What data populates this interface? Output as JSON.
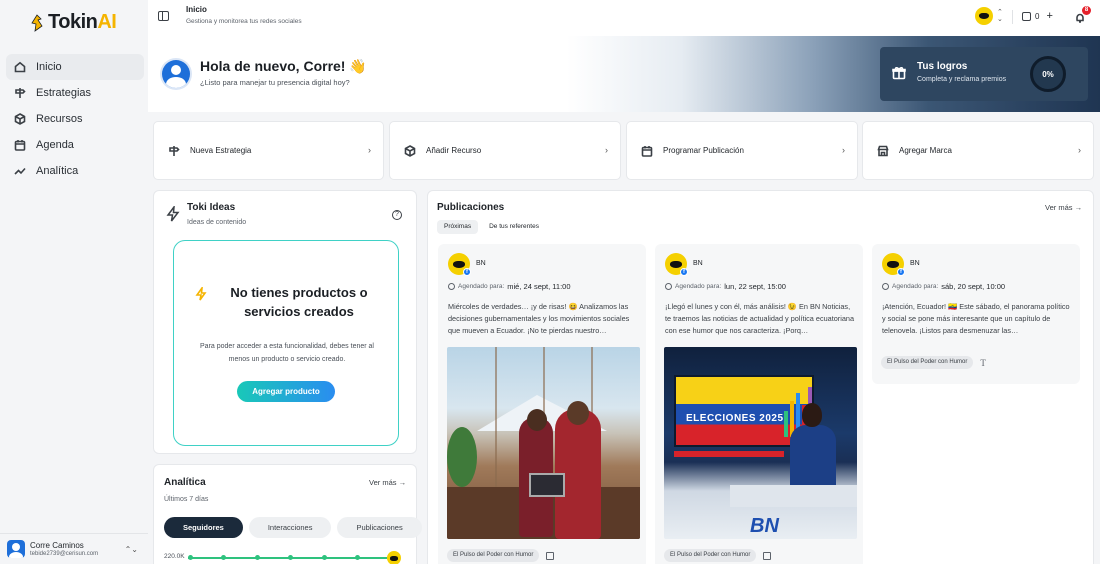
{
  "app": {
    "logo_text": "Tokin",
    "logo_accent": "AI",
    "brand_color": "#f5b400"
  },
  "sidebar": {
    "items": [
      {
        "label": "Inicio",
        "icon": "home-icon",
        "active": true
      },
      {
        "label": "Estrategias",
        "icon": "signpost-icon",
        "active": false
      },
      {
        "label": "Recursos",
        "icon": "package-icon",
        "active": false
      },
      {
        "label": "Agenda",
        "icon": "calendar-icon",
        "active": false
      },
      {
        "label": "Analítica",
        "icon": "trend-icon",
        "active": false
      }
    ],
    "user": {
      "name": "Corre Caminos",
      "email": "tebide2739@cerisun.com"
    }
  },
  "topbar": {
    "title": "Inicio",
    "subtitle": "Gestiona y monitorea tus redes sociales",
    "credits": "0",
    "notifications": "8"
  },
  "hero": {
    "greeting": "Hola de nuevo, Corre! 👋",
    "subtitle": "¿Listo para manejar tu presencia digital hoy?",
    "logros": {
      "title": "Tus logros",
      "subtitle": "Completa y reclama premios",
      "percent": "0%"
    }
  },
  "quick_actions": [
    {
      "label": "Nueva Estrategia",
      "icon": "signpost-icon"
    },
    {
      "label": "Añadir Recurso",
      "icon": "package-icon"
    },
    {
      "label": "Programar Publicación",
      "icon": "calendar-icon"
    },
    {
      "label": "Agregar Marca",
      "icon": "store-icon"
    }
  ],
  "ideas": {
    "title": "Toki Ideas",
    "subtitle": "Ideas de contenido",
    "empty_title": "No tienes productos o servicios creados",
    "empty_text": "Para poder acceder a esta funcionalidad, debes tener al menos un producto o servicio creado.",
    "button": "Agregar producto"
  },
  "analitica": {
    "title": "Analítica",
    "more": "Ver más →",
    "period": "Últimos 7 días",
    "tabs": [
      "Seguidores",
      "Interacciones",
      "Publicaciones"
    ],
    "active_tab": "Seguidores",
    "y_label": "220.0K"
  },
  "publicaciones": {
    "title": "Publicaciones",
    "more": "Ver más →",
    "tabs": [
      "Próximas",
      "De tus referentes"
    ],
    "active_tab": "Próximas",
    "scheduled_label": "Agendado para:",
    "posts": [
      {
        "account": "BN",
        "date": "mié, 24 sept, 11:00",
        "text": "Miércoles de verdades… ¡y de risas! 😆 Analizamos las decisiones gubernamentales y los movimientos sociales que mueven a Ecuador. ¡No te pierdas nuestro…",
        "tag": "El Pulso del Poder con Humor",
        "media": "image"
      },
      {
        "account": "BN",
        "date": "lun, 22 sept, 15:00",
        "text": "¡Llegó el lunes y con él, más análisis! 😉 En BN Noticias, te traemos las noticias de actualidad y política ecuatoriana con ese humor que nos caracteriza. ¡Porq…",
        "tag": "El Pulso del Poder con Humor",
        "media": "image",
        "image_text": "ELECCIONES 2025",
        "image_logo": "BN"
      },
      {
        "account": "BN",
        "date": "sáb, 20 sept, 10:00",
        "text": "¡Atención, Ecuador! 🇪🇨 Este sábado, el panorama político y social se pone más interesante que un capítulo de telenovela. ¡Listos para desmenuzar las…",
        "tag": "El Pulso del Poder con Humor",
        "media": "text"
      }
    ]
  }
}
